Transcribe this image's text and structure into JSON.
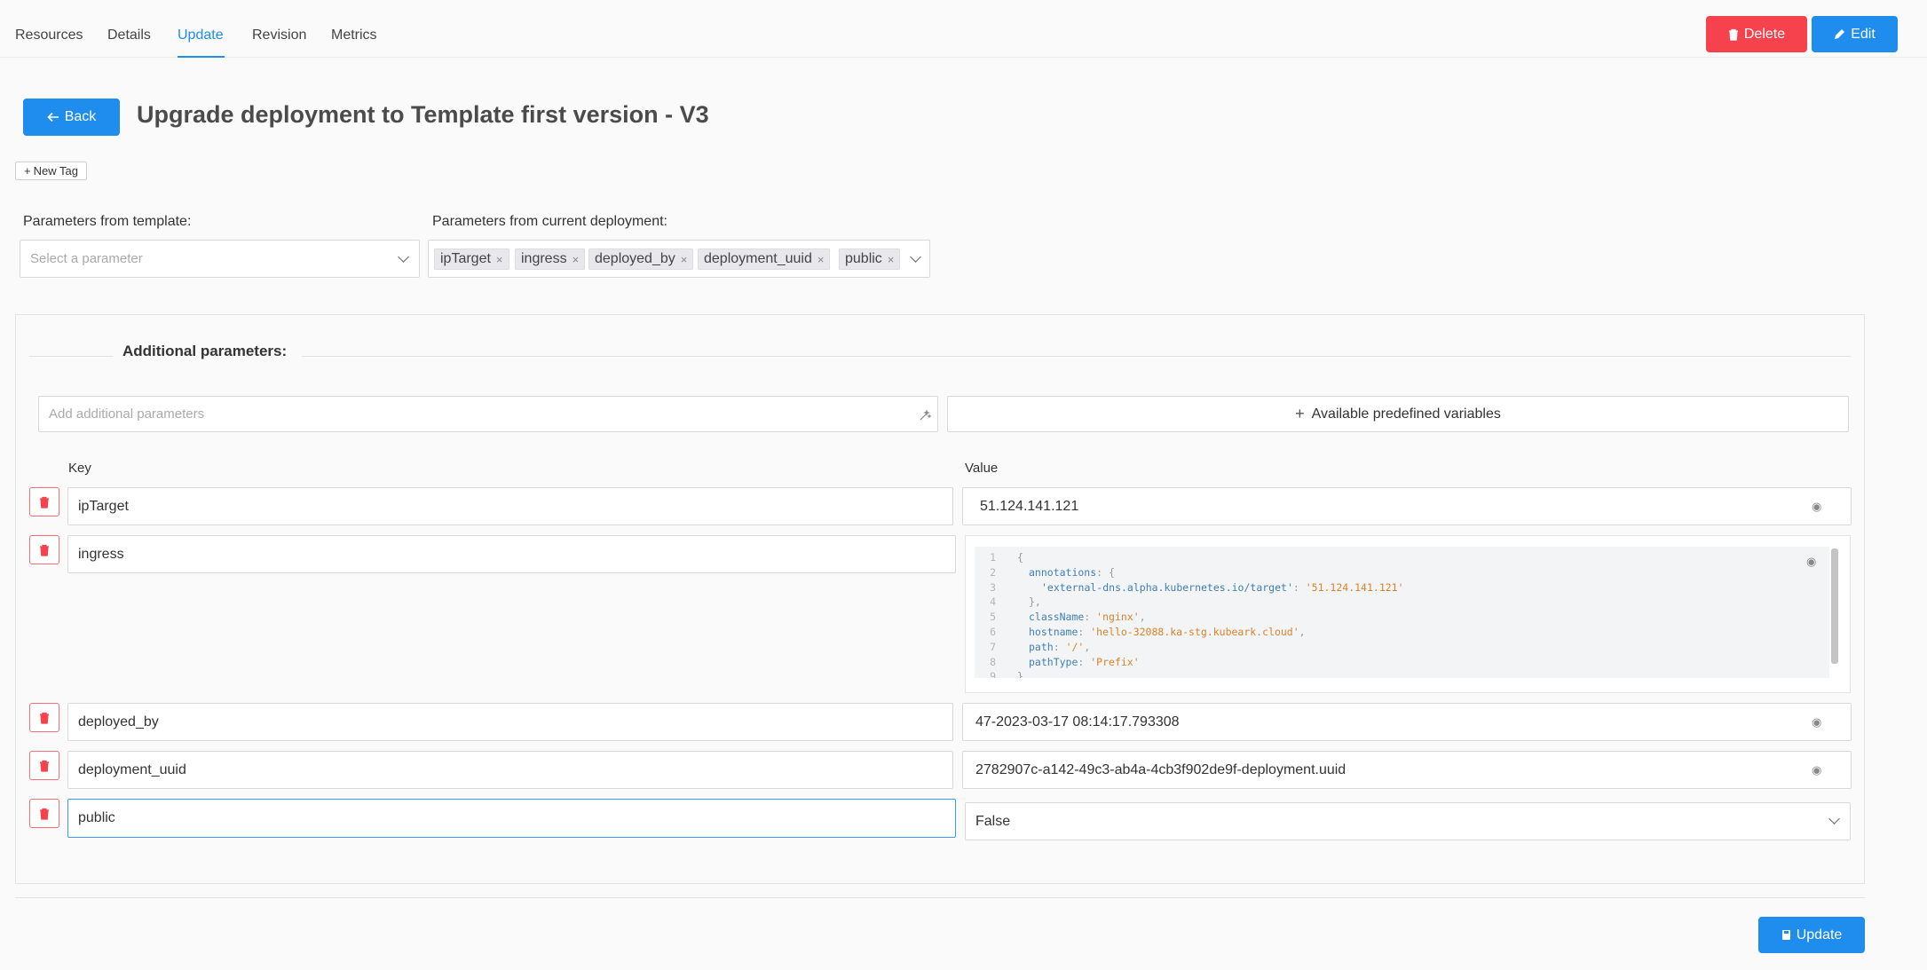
{
  "tabs": [
    "Resources",
    "Details",
    "Update",
    "Revision",
    "Metrics"
  ],
  "active_tab": "Update",
  "toolbar": {
    "delete_label": "Delete",
    "edit_label": "Edit"
  },
  "header": {
    "back_label": "Back",
    "title": "Upgrade deployment to Template first version - V3"
  },
  "new_tag_label": "New Tag",
  "template_params": {
    "label": "Parameters from template:",
    "placeholder": "Select a parameter"
  },
  "current_params": {
    "label": "Parameters from current deployment:",
    "tags": [
      "ipTarget",
      "ingress",
      "deployed_by",
      "deployment_uuid",
      "public"
    ]
  },
  "additional": {
    "title": "Additional parameters:",
    "input_placeholder": "Add additional parameters",
    "predefined_label": "Available predefined variables",
    "key_header": "Key",
    "value_header": "Value",
    "rows": [
      {
        "key": "ipTarget",
        "value": "51.124.141.121"
      },
      {
        "key": "ingress",
        "value": ""
      },
      {
        "key": "deployed_by",
        "value": "47-2023-03-17 08:14:17.793308"
      },
      {
        "key": "deployment_uuid",
        "value": "2782907c-a142-49c3-ab4a-4cb3f902de9f-deployment.uuid"
      },
      {
        "key": "public",
        "value": "False"
      }
    ]
  },
  "ingress_code": {
    "line_numbers": [
      "1",
      "2",
      "3",
      "4",
      "5",
      "6",
      "7",
      "8",
      "9"
    ],
    "annotations_key": "annotations",
    "annotation_key": "'external-dns.alpha.kubernetes.io/target'",
    "annotation_value": "'51.124.141.121'",
    "className_key": "className",
    "className_value": "'nginx'",
    "hostname_key": "hostname",
    "hostname_value": "'hello-32088.ka-stg.kubeark.cloud'",
    "path_key": "path",
    "path_value": "'/'",
    "pathType_key": "pathType",
    "pathType_value": "'Prefix'"
  },
  "update_label": "Update",
  "colors": {
    "primary": "#1f8ded",
    "danger": "#f5424c"
  }
}
